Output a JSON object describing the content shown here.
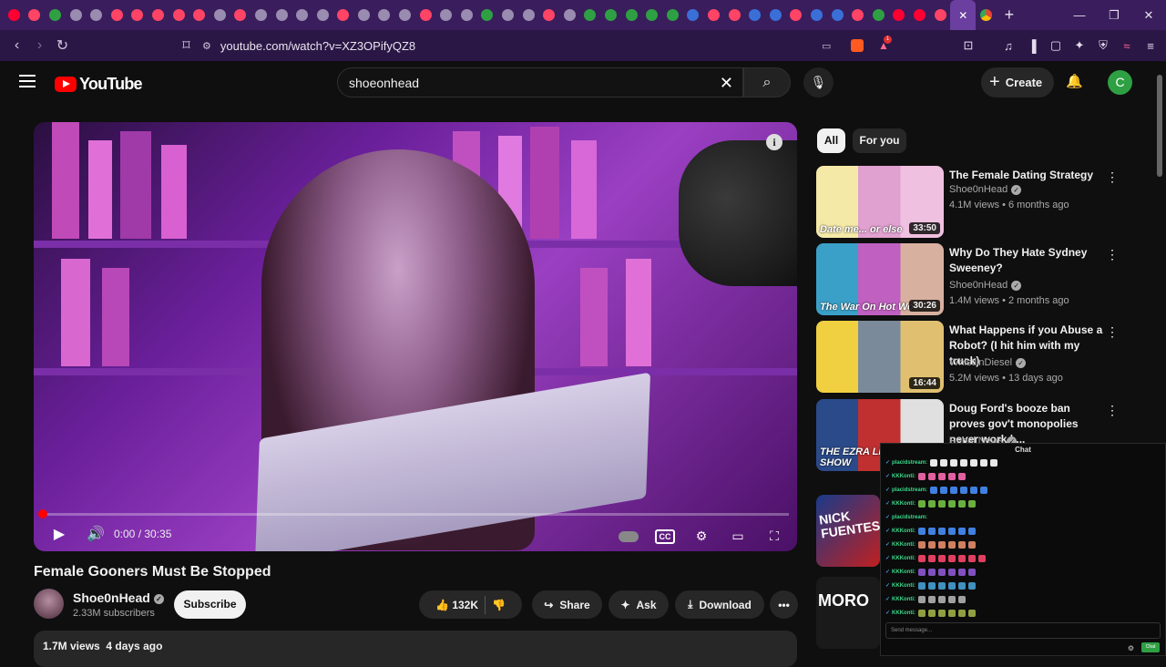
{
  "browser": {
    "tab_count": 48,
    "tab_colors": [
      "#ff0033",
      "#ff4466",
      "#2ea043",
      "#9a8cb0",
      "#9a8cb0",
      "#ff4466",
      "#ff4466",
      "#ff4466",
      "#ff4466",
      "#ff4466",
      "#9a8cb0",
      "#ff4466",
      "#9a8cb0",
      "#9a8cb0",
      "#9a8cb0",
      "#9a8cb0",
      "#ff4466",
      "#9a8cb0",
      "#9a8cb0",
      "#9a8cb0",
      "#ff4466",
      "#9a8cb0",
      "#9a8cb0",
      "#2ea043",
      "#9a8cb0",
      "#9a8cb0",
      "#ff4466",
      "#9a8cb0",
      "#2ea043",
      "#2ea043",
      "#2ea043",
      "#2ea043",
      "#2ea043",
      "#3a6fd8",
      "#ff4466",
      "#ff4466",
      "#3a6fd8",
      "#3a6fd8",
      "#ff4466",
      "#3a6fd8",
      "#3a6fd8",
      "#ff4466",
      "#2ea043",
      "#ff0033",
      "#ff0033",
      "#ff4466"
    ],
    "url": "youtube.com/watch?v=XZ3OPifyQZ8",
    "notification_count": "1"
  },
  "header": {
    "logo_text": "YouTube",
    "search_value": "shoeonhead",
    "create_label": "Create",
    "avatar_letter": "C"
  },
  "player": {
    "time": "0:00 / 30:35",
    "progress_fraction": 0.0
  },
  "video": {
    "title": "Female Gooners Must Be Stopped",
    "channel": "Shoe0nHead",
    "subscribers": "2.33M subscribers",
    "subscribe_label": "Subscribe",
    "likes": "132K",
    "share_label": "Share",
    "ask_label": "Ask",
    "download_label": "Download",
    "views_date": "1.7M views  4 days ago"
  },
  "chips": [
    "All",
    "For you"
  ],
  "recommendations": [
    {
      "title": "The Female Dating Strategy",
      "channel": "Shoe0nHead",
      "meta": "4.1M views • 6 months ago",
      "duration": "33:50",
      "thumb_caption": "Date me... or else",
      "colors": [
        "#f5e9a8",
        "#e0a0d0",
        "#f0c0e0"
      ]
    },
    {
      "title": "Why Do They Hate Sydney Sweeney?",
      "channel": "Shoe0nHead",
      "meta": "1.4M views • 2 months ago",
      "duration": "30:26",
      "thumb_caption": "The War On Hot Wo",
      "colors": [
        "#3aa0c8",
        "#c060c0",
        "#d8b0a0"
      ]
    },
    {
      "title": "What Happens if you Abuse a Robot? (I hit him with my truck)",
      "channel": "WhistlinDiesel",
      "meta": "5.2M views • 13 days ago",
      "duration": "16:44",
      "thumb_caption": "",
      "colors": [
        "#f0d040",
        "#7a8a9a",
        "#e0c070"
      ]
    },
    {
      "title": "Doug Ford's booze ban proves gov't monopolies never work | ...",
      "channel": "Rebel News",
      "meta": "",
      "duration": "",
      "thumb_caption": "THE EZRA LEVANT SHOW",
      "colors": [
        "#2a4a8a",
        "#c03030",
        "#e0e0e0"
      ]
    }
  ],
  "partial_thumbs": [
    "NICK FUENTES",
    "MORO"
  ],
  "chat": {
    "header": "Chat",
    "send_placeholder": "Send message...",
    "button_label": "Chat",
    "messages": [
      {
        "user": "placidstream:",
        "emote_color": "#e8e8e8",
        "count": 7
      },
      {
        "user": "KKKonti:",
        "emote_color": "#e060a0",
        "count": 5
      },
      {
        "user": "placidstream:",
        "emote_color": "#4080e0",
        "count": 6
      },
      {
        "user": "KKKonti:",
        "emote_color": "#6ab040",
        "count": 6
      },
      {
        "user": "placidstream:",
        "emote_color": "#000000",
        "count": 0
      },
      {
        "user": "KKKonti:",
        "emote_color": "#4080e0",
        "count": 6
      },
      {
        "user": "KKKonti:",
        "emote_color": "#d08060",
        "count": 6
      },
      {
        "user": "KKKonti:",
        "emote_color": "#e04060",
        "count": 7
      },
      {
        "user": "KKKonti:",
        "emote_color": "#8050c0",
        "count": 6
      },
      {
        "user": "KKKonti:",
        "emote_color": "#4090c0",
        "count": 6
      },
      {
        "user": "KKKonti:",
        "emote_color": "#a0a0a0",
        "count": 5
      },
      {
        "user": "KKKonti:",
        "emote_color": "#90a040",
        "count": 6
      }
    ]
  }
}
